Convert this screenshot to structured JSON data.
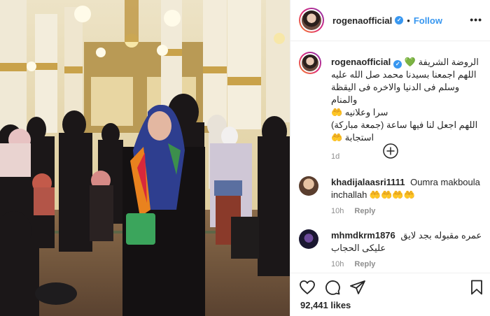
{
  "post": {
    "username": "rogenaofficial",
    "verified_mark": "✓",
    "separator": "•",
    "follow_label": "Follow",
    "more_label": "•••"
  },
  "caption": {
    "username": "rogenaofficial",
    "line1": "الروضة الشريفة 💚",
    "line2": "اللهم اجمعنا بسيدنا محمد صل الله عليه",
    "line3": "وسلم فى الدنيا والاخره فى اليقظة والمنام",
    "line4": "سرا وعلانيه 🤲",
    "line5": "اللهم اجعل لنا فيها ساعة (جمعة مباركة)",
    "line6": "استجابة 🤲",
    "age": "1d"
  },
  "comments": [
    {
      "username": "khadijalaasri1111",
      "text": "Oumra makboula inchallah 🤲🤲🤲🤲",
      "age": "10h",
      "reply_label": "Reply"
    },
    {
      "username": "mhmdkrm1876",
      "text_line1": "عمره مقبوله بجد لايق",
      "text_line2": "عليكى الحجاب",
      "age": "10h",
      "reply_label": "Reply"
    }
  ],
  "likes": "92,441 likes",
  "colors": {
    "accent": "#3897f0",
    "text": "#262626",
    "muted": "#8e8e8e",
    "border": "#efefef"
  },
  "icons": [
    "heart-icon",
    "comment-icon",
    "share-icon",
    "bookmark-icon",
    "add-comment-icon",
    "more-icon",
    "verified-icon"
  ]
}
